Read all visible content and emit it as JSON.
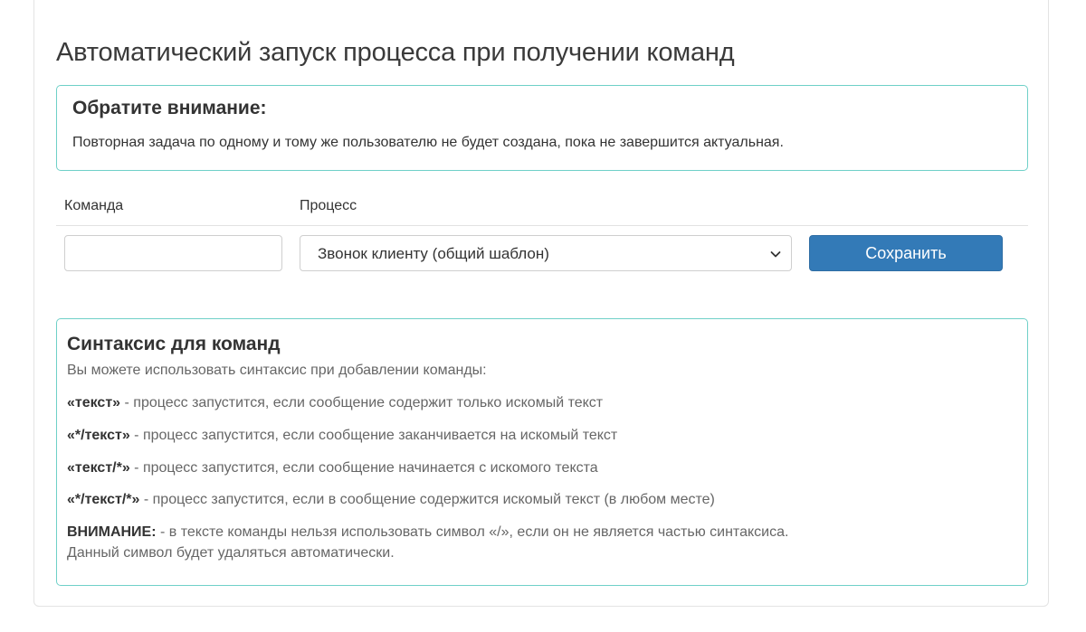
{
  "page": {
    "title": "Автоматический запуск процесса при получении команд"
  },
  "notice": {
    "title": "Обратите внимание:",
    "text": "Повторная задача по одному и тому же пользователю не будет создана, пока не завершится актуальная."
  },
  "form": {
    "command_label": "Команда",
    "process_label": "Процесс",
    "command_value": "",
    "process_selected": "Звонок клиенту (общий шаблон)",
    "save_label": "Сохранить",
    "chevron_icon": "chevron-down-icon",
    "colors": {
      "button": "#337ab7",
      "accent_border": "#6fd0c8"
    }
  },
  "syntax": {
    "title": "Синтаксис для команд",
    "intro": "Вы можете использовать синтаксис при добавлении команды:",
    "rules": [
      {
        "pattern": "«текст»",
        "description": " - процесс запустится, если сообщение содержит только искомый текст"
      },
      {
        "pattern": "«*/текст»",
        "description": " - процесс запустится, если сообщение заканчивается на искомый текст"
      },
      {
        "pattern": "«текст/*»",
        "description": " - процесс запустится, если сообщение начинается с искомого текста"
      },
      {
        "pattern": "«*/текст/*»",
        "description": " - процесс запустится, если в сообщение содержится искомый текст (в любом месте)"
      }
    ],
    "warning": {
      "label": "ВНИМАНИЕ:",
      "text": " - в тексте команды нельзя использовать символ «/», если он не является частью синтаксиса.",
      "text2": "Данный символ будет удаляться автоматически."
    }
  }
}
